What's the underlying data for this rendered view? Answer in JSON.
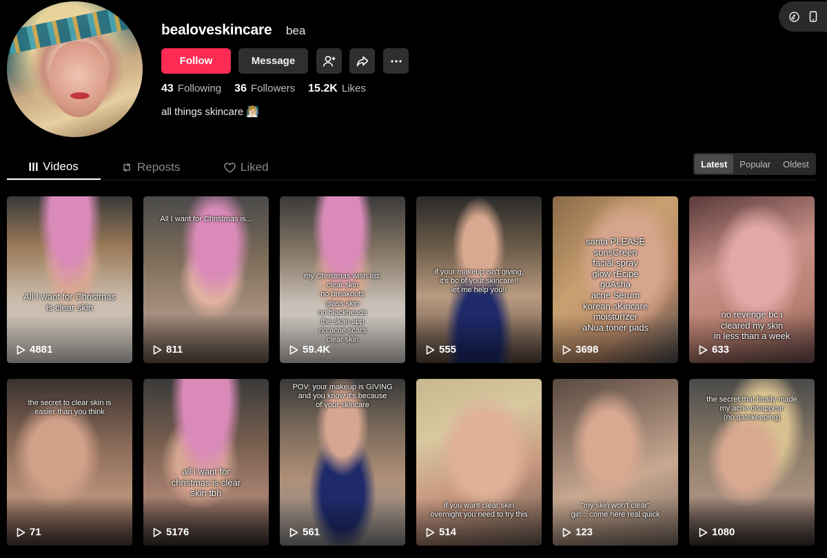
{
  "top_controls": {
    "icons": [
      "tiktok-icon",
      "mobile-icon"
    ]
  },
  "profile": {
    "username": "bealoveskincare",
    "nickname": "bea",
    "follow_label": "Follow",
    "message_label": "Message",
    "stats": [
      {
        "num": "43",
        "label": "Following"
      },
      {
        "num": "36",
        "label": "Followers"
      },
      {
        "num": "15.2K",
        "label": "Likes"
      }
    ],
    "bio": "all things skincare 🧖🏼‍♀️"
  },
  "tabs": [
    {
      "label": "Videos",
      "icon": "grid-icon",
      "active": true
    },
    {
      "label": "Reposts",
      "icon": "repost-icon",
      "active": false
    },
    {
      "label": "Liked",
      "icon": "heart-icon",
      "active": false
    }
  ],
  "sort": {
    "options": [
      "Latest",
      "Popular",
      "Oldest"
    ],
    "active": "Latest"
  },
  "videos": [
    {
      "views": "4881",
      "caption": "All I want for Christmas\nis clear skin"
    },
    {
      "views": "811",
      "caption": "All I want for Christmas is..."
    },
    {
      "views": "59.4K",
      "caption": "my Christmas wish list:\nclear skin\nno breakouts\nglass skin\nno blackheads\nthe skan app\nno acne scars\nclear skin"
    },
    {
      "views": "555",
      "caption": "if your makeup isn't giving,\nit's bc of your skincare!!\nlet me help you!!"
    },
    {
      "views": "3698",
      "caption": "santa PLEASE\nsunsCreen\nfacial spray\nglow rEcipe\nguAsha\nacne Serum\nkorean sKincare\nmoisturIzer\naNua toner pads"
    },
    {
      "views": "633",
      "caption": "no revenge bc i\ncleared my skin\nin less than a week"
    },
    {
      "views": "71",
      "caption": "the secret to clear skin is\neasier than you think"
    },
    {
      "views": "5176",
      "caption": "all i want for\nchristmas is clear\nskin tbh"
    },
    {
      "views": "561",
      "caption": "POV: your makeup is GIVING\nand you know it's because\nof your skincare"
    },
    {
      "views": "514",
      "caption": "if you want clear skin\novernight you need to try this"
    },
    {
      "views": "123",
      "caption": "\"my skin won't clear\"\ngirl... come here real quick"
    },
    {
      "views": "1080",
      "caption": "the secret that finally made\nmy acne disappear\n(no gatekeeping)"
    }
  ],
  "colors": {
    "accent": "#fe2c55",
    "button_bg": "#2f2f2f",
    "background": "#000000"
  }
}
